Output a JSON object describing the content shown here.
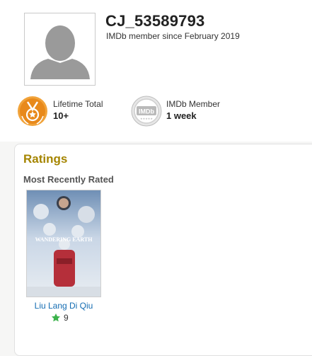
{
  "profile": {
    "username": "CJ_53589793",
    "member_since": "IMDb member since February 2019"
  },
  "badges": [
    {
      "label": "Lifetime Total",
      "value": "10+",
      "icon": "medal-icon",
      "color": "#e8891b"
    },
    {
      "label": "IMDb Member",
      "value": "1 week",
      "icon": "imdb-seal-icon",
      "seal_text": "IMDb",
      "color": "#bdbdbd"
    }
  ],
  "ratings": {
    "title": "Ratings",
    "recent_label": "Most Recently Rated",
    "items": [
      {
        "title": "Liu Lang Di Qiu",
        "rating": "9",
        "poster_text": "WANDERING EARTH",
        "star_color": "#3bb24b"
      }
    ]
  },
  "colors": {
    "ratings_title": "#a58500",
    "link": "#136cb2",
    "star": "#3bb24b",
    "avatar_silhouette": "#9a9a9a"
  }
}
